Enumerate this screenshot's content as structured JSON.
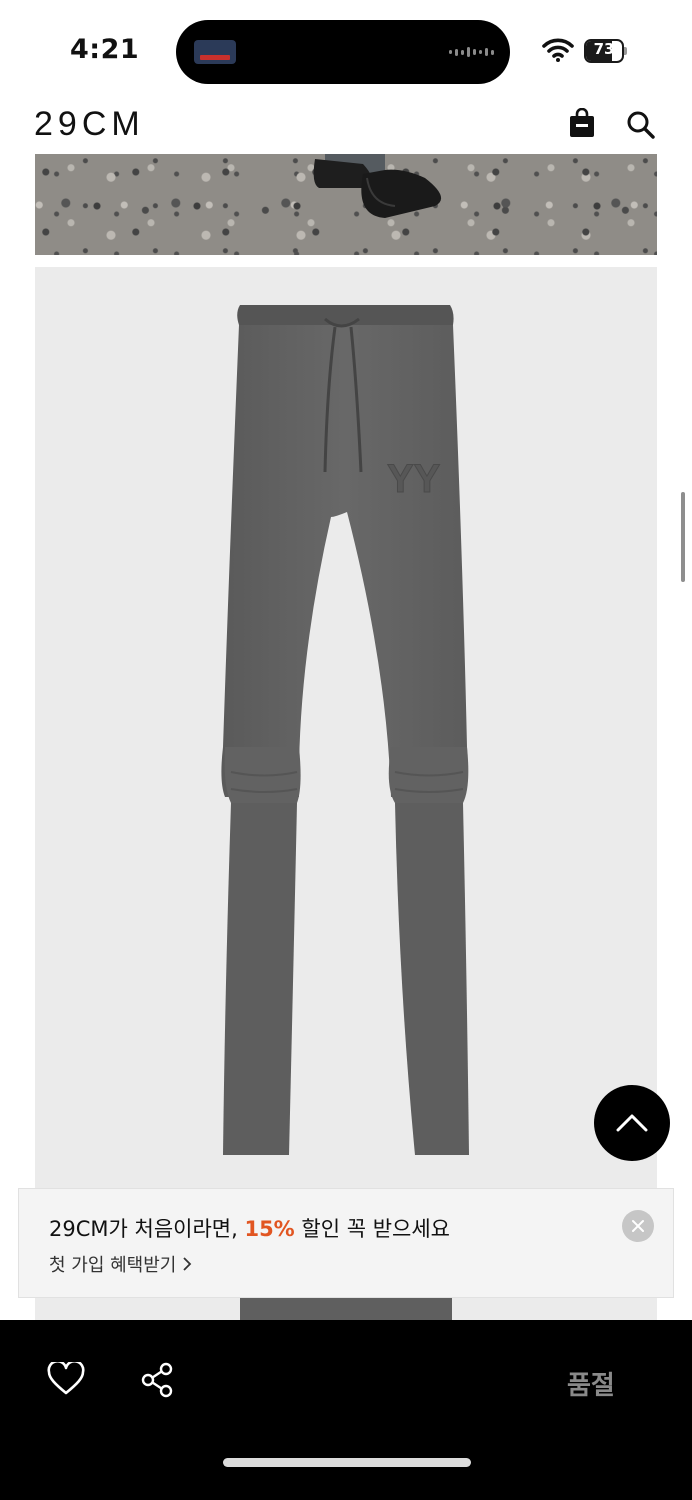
{
  "status_bar": {
    "time": "4:21",
    "battery": "73",
    "battery_level": 0.73
  },
  "header": {
    "logo": "29CM"
  },
  "product_images": {
    "top_photo": "photo-lifestyle",
    "main_photo": "photo-product-pants",
    "panel_color": "#ebebeb",
    "garment_color": "#5f5f5f"
  },
  "promo": {
    "title_prefix": "29CM가 처음이라면, ",
    "title_highlight": "15%",
    "title_suffix": " 할인 꼭 받으세요",
    "link": "첫 가입 혜택받기",
    "highlight_color": "#e15521"
  },
  "bottom_bar": {
    "status": "품절"
  },
  "icons": {
    "bag": "shopping-bag-icon",
    "search": "search-icon",
    "scroll_top": "chevron-up-icon",
    "close": "close-icon",
    "like": "heart-icon",
    "share": "share-icon"
  }
}
